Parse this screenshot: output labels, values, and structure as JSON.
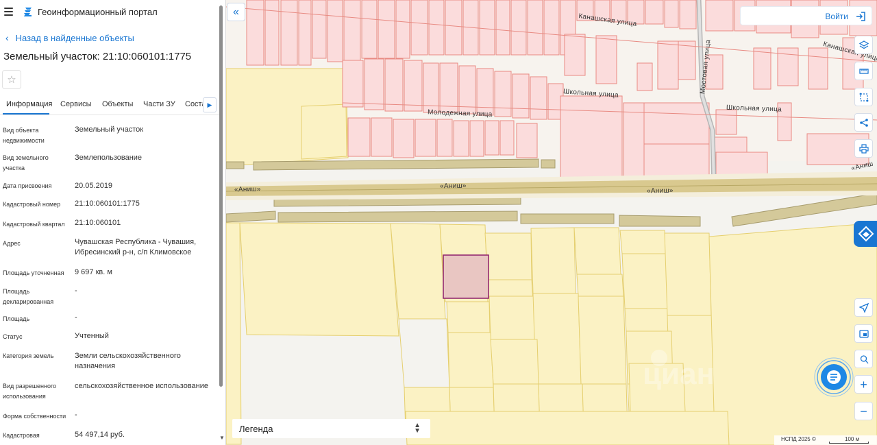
{
  "header": {
    "portal_title": "Геоинформационный портал"
  },
  "nav": {
    "back_label": "Назад в найденные объекты"
  },
  "parcel": {
    "title": "Земельный участок: 21:10:060101:1775"
  },
  "tabs": [
    {
      "label": "Информация"
    },
    {
      "label": "Сервисы"
    },
    {
      "label": "Объекты"
    },
    {
      "label": "Части ЗУ"
    },
    {
      "label": "Соста"
    }
  ],
  "properties": [
    {
      "key": "Вид объекта недвижимости",
      "value": "Земельный участок"
    },
    {
      "key": "Вид земельного участка",
      "value": "Землепользование"
    },
    {
      "key": "Дата присвоения",
      "value": "20.05.2019"
    },
    {
      "key": "Кадастровый номер",
      "value": "21:10:060101:1775"
    },
    {
      "key": "Кадастровый квартал",
      "value": "21:10:060101"
    },
    {
      "key": "Адрес",
      "value": "Чувашская Республика - Чувашия, Ибресинский р-н, с/п Климовское"
    },
    {
      "key": "Площадь уточненная",
      "value": "9 697 кв. м"
    },
    {
      "key": "Площадь декларированная",
      "value": "-"
    },
    {
      "key": "Площадь",
      "value": "-"
    },
    {
      "key": "Статус",
      "value": "Учтенный"
    },
    {
      "key": "Категория земель",
      "value": "Земли сельскохозяйственного назначения"
    },
    {
      "key": "Вид разрешенного использования",
      "value": "сельскохозяйственное использование"
    },
    {
      "key": "Форма собственности",
      "value": "-"
    },
    {
      "key": "Кадастровая",
      "value": "54 497,14 руб."
    }
  ],
  "map": {
    "login_label": "Войти",
    "legend_label": "Легенда",
    "attribution": "НСПД 2025 ©",
    "scale_label": "100 м",
    "street_labels": {
      "kanashskaya": "Канашская улица",
      "kanashskaya_right": "Канашская улица",
      "shkolnaya": "Школьная улица",
      "shkolnaya_right": "Школьная улица",
      "molodezhnaya": "Молодежная улица",
      "mostovaya": "Мостовая улица",
      "anish_left": "«Аниш»",
      "anish_mid": "«Аниш»",
      "anish_right": "«Аниш»",
      "anish_far": "«Аниш"
    },
    "colors": {
      "residential_fill": "#fbdcdc",
      "residential_stroke": "#e88a82",
      "agri_fill": "#fbf2c4",
      "agri_stroke": "#e5cf6f",
      "selected_fill": "#e9c6c2",
      "selected_stroke": "#8e1f6b",
      "road_fill": "#d4c99a",
      "accent": "#1976d2"
    }
  }
}
